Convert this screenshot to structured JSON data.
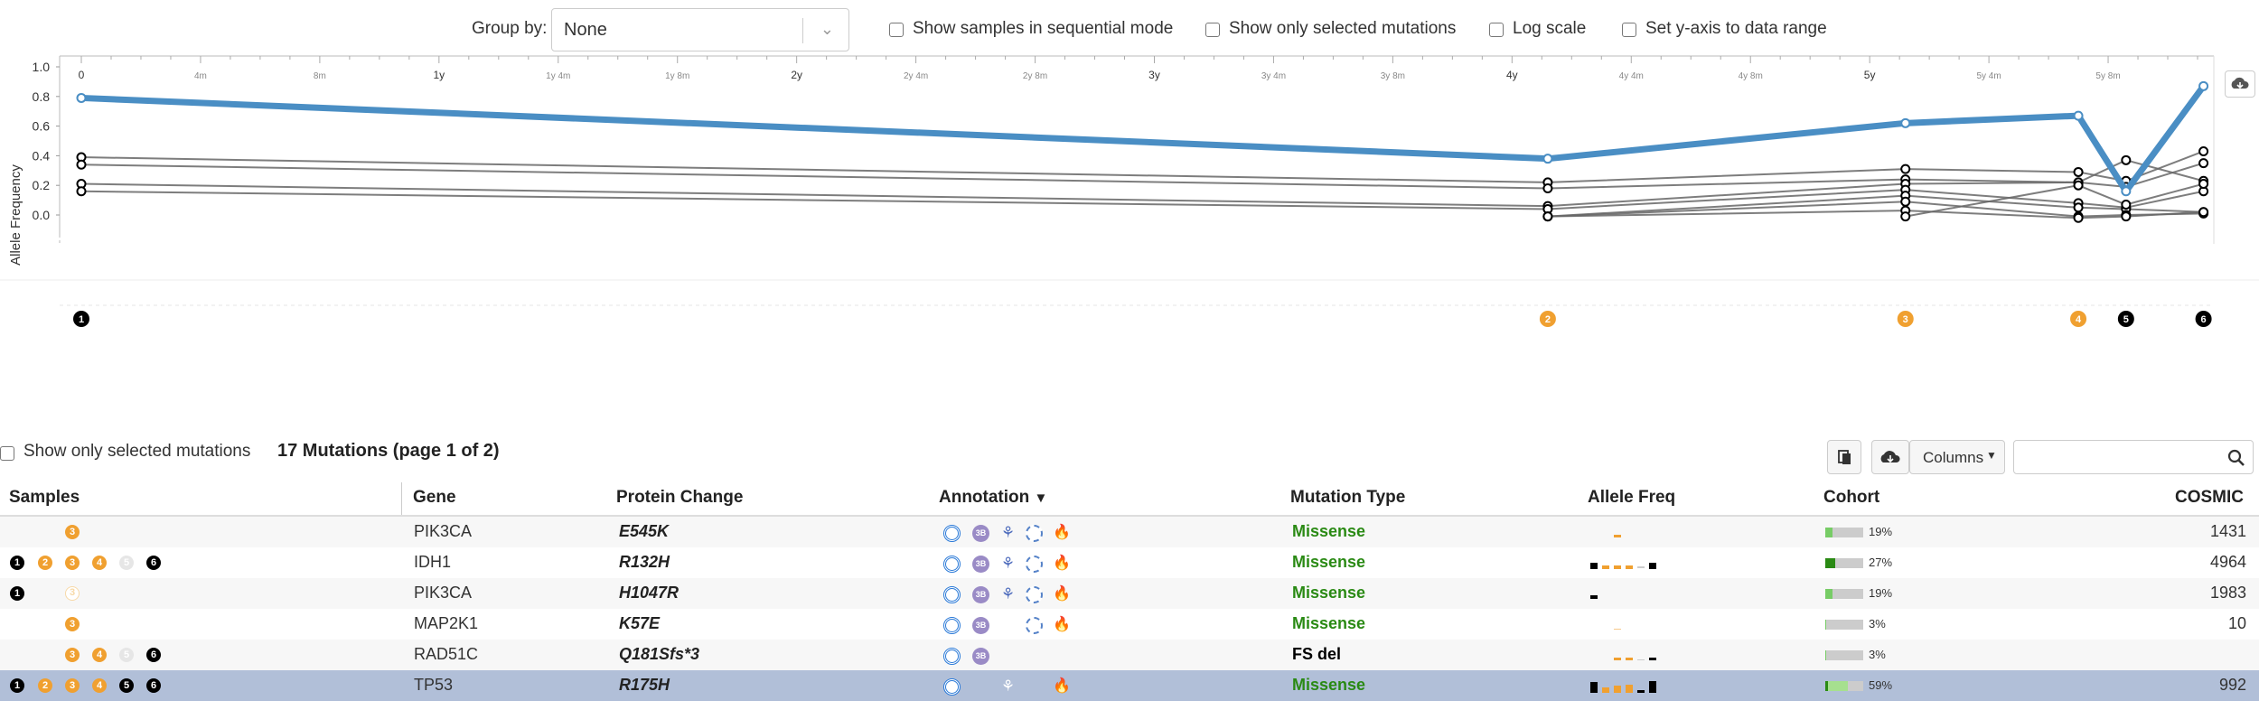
{
  "controls": {
    "group_by_label": "Group by:",
    "group_by_value": "None",
    "sequential_label": "Show samples in sequential mode",
    "only_selected_label": "Show only selected mutations",
    "log_scale_label": "Log scale",
    "yaxis_range_label": "Set y-axis to data range"
  },
  "chart_data": {
    "type": "line",
    "ylabel": "Allele Frequency",
    "ylim": [
      0,
      1.0
    ],
    "y_ticks": [
      "1.0",
      "0.8",
      "0.6",
      "0.4",
      "0.2",
      "0.0"
    ],
    "x_major_ticks": [
      "0",
      "1y",
      "2y",
      "3y",
      "4y",
      "5y"
    ],
    "x_minor_ticks": [
      "4m",
      "8m",
      "1y 4m",
      "1y 8m",
      "2y 4m",
      "2y 8m",
      "3y 4m",
      "3y 8m",
      "4y 4m",
      "4y 8m",
      "5y 4m",
      "5y 8m"
    ],
    "x_ticks_months": [
      0,
      4,
      8,
      12,
      16,
      20,
      24,
      28,
      32,
      36,
      40,
      44,
      48,
      52,
      56,
      60,
      64,
      68
    ],
    "x_tick_labels": [
      "0",
      "4m",
      "8m",
      "1y",
      "1y 4m",
      "1y 8m",
      "2y",
      "2y 4m",
      "2y 8m",
      "3y",
      "3y 4m",
      "3y 8m",
      "4y",
      "4y 4m",
      "4y 8m",
      "5y",
      "5y 4m",
      "5y 8m"
    ],
    "x_range_months": [
      0,
      71
    ],
    "sample_months": [
      0,
      49.2,
      61.2,
      67,
      68.6,
      71.2
    ],
    "samples": [
      {
        "label": "1",
        "color": "#000000"
      },
      {
        "label": "2",
        "color": "#f0a030"
      },
      {
        "label": "3",
        "color": "#f0a030"
      },
      {
        "label": "4",
        "color": "#f0a030"
      },
      {
        "label": "5",
        "color": "#000000"
      },
      {
        "label": "6",
        "color": "#000000"
      }
    ],
    "highlight_series": {
      "name": "TP53",
      "color": "#4a8ec4",
      "values": [
        0.79,
        0.38,
        0.62,
        0.67,
        0.16,
        0.87
      ]
    },
    "series": [
      {
        "values": [
          0.39,
          0.22,
          0.31,
          0.29,
          0.23,
          0.43
        ]
      },
      {
        "values": [
          0.34,
          0.18,
          0.24,
          0.22,
          0.19,
          0.35
        ]
      },
      {
        "values": [
          0.21,
          0.06,
          0.21,
          0.22,
          0.37,
          0.23
        ]
      },
      {
        "values": [
          0.16,
          0.04,
          0.17,
          0.08,
          0.05,
          0.16
        ]
      },
      {
        "values": [
          null,
          -0.01,
          0.13,
          0.05,
          0.04,
          0.02
        ]
      },
      {
        "values": [
          null,
          -0.01,
          0.09,
          -0.01,
          0.0,
          0.01
        ]
      },
      {
        "values": [
          null,
          -0.01,
          0.03,
          -0.02,
          -0.01,
          0.02
        ]
      },
      {
        "values": [
          null,
          null,
          -0.01,
          0.2,
          0.07,
          0.21
        ]
      }
    ]
  },
  "table": {
    "only_selected_label": "Show only selected mutations",
    "title": "17 Mutations (page 1 of 2)",
    "columns_button": "Columns",
    "headers": {
      "samples": "Samples",
      "gene": "Gene",
      "protein_change": "Protein Change",
      "annotation": "Annotation",
      "mutation_type": "Mutation Type",
      "allele_freq": "Allele Freq",
      "cohort": "Cohort",
      "cosmic": "COSMIC"
    },
    "sort_indicator": "▼",
    "rows": [
      {
        "gene": "PIK3CA",
        "protein_change": "E545K",
        "mutation_type": "Missense",
        "cohort_pct": "19%",
        "cohort_frac": 0.19,
        "cosmic": "1431"
      },
      {
        "gene": "IDH1",
        "protein_change": "R132H",
        "mutation_type": "Missense",
        "cohort_pct": "27%",
        "cohort_frac": 0.27,
        "cosmic": "4964"
      },
      {
        "gene": "PIK3CA",
        "protein_change": "H1047R",
        "mutation_type": "Missense",
        "cohort_pct": "19%",
        "cohort_frac": 0.19,
        "cosmic": "1983"
      },
      {
        "gene": "MAP2K1",
        "protein_change": "K57E",
        "mutation_type": "Missense",
        "cohort_pct": "3%",
        "cohort_frac": 0.03,
        "cosmic": "10"
      },
      {
        "gene": "RAD51C",
        "protein_change": "Q181Sfs*3",
        "mutation_type": "FS del",
        "cohort_pct": "3%",
        "cohort_frac": 0.03,
        "cosmic": ""
      },
      {
        "gene": "TP53",
        "protein_change": "R175H",
        "mutation_type": "Missense",
        "cohort_pct": "59%",
        "cohort_frac": 0.59,
        "cosmic": "992"
      }
    ],
    "sample_dot_labels": [
      "1",
      "2",
      "3",
      "4",
      "5",
      "6"
    ]
  },
  "colors": {
    "highlight": "#4a8ec4",
    "selected_row": "#b1bfd8",
    "missense": "#2a8a14",
    "sample_orange": "#f0a030"
  }
}
